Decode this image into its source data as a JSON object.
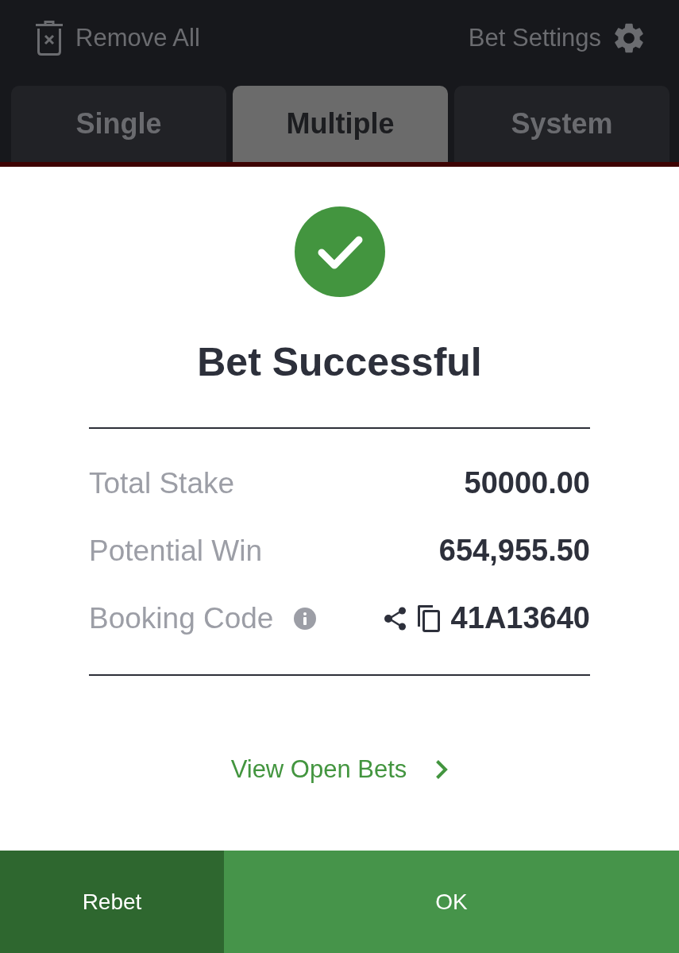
{
  "header": {
    "remove_all": "Remove All",
    "bet_settings": "Bet Settings"
  },
  "tabs": [
    {
      "label": "Single",
      "selected": false
    },
    {
      "label": "Multiple",
      "selected": true
    },
    {
      "label": "System",
      "selected": false
    }
  ],
  "dialog": {
    "title": "Bet Successful",
    "rows": [
      {
        "kind": "amount",
        "label": "Total Stake",
        "value": "50000.00"
      },
      {
        "kind": "amount",
        "label": "Potential Win",
        "value": "654,955.50"
      },
      {
        "kind": "code",
        "label": "Booking Code",
        "value": "41A13640"
      }
    ],
    "link": "View Open Bets"
  },
  "buttons": [
    {
      "kind": "secondary",
      "label": "Rebet"
    },
    {
      "kind": "primary",
      "label": "OK"
    }
  ]
}
